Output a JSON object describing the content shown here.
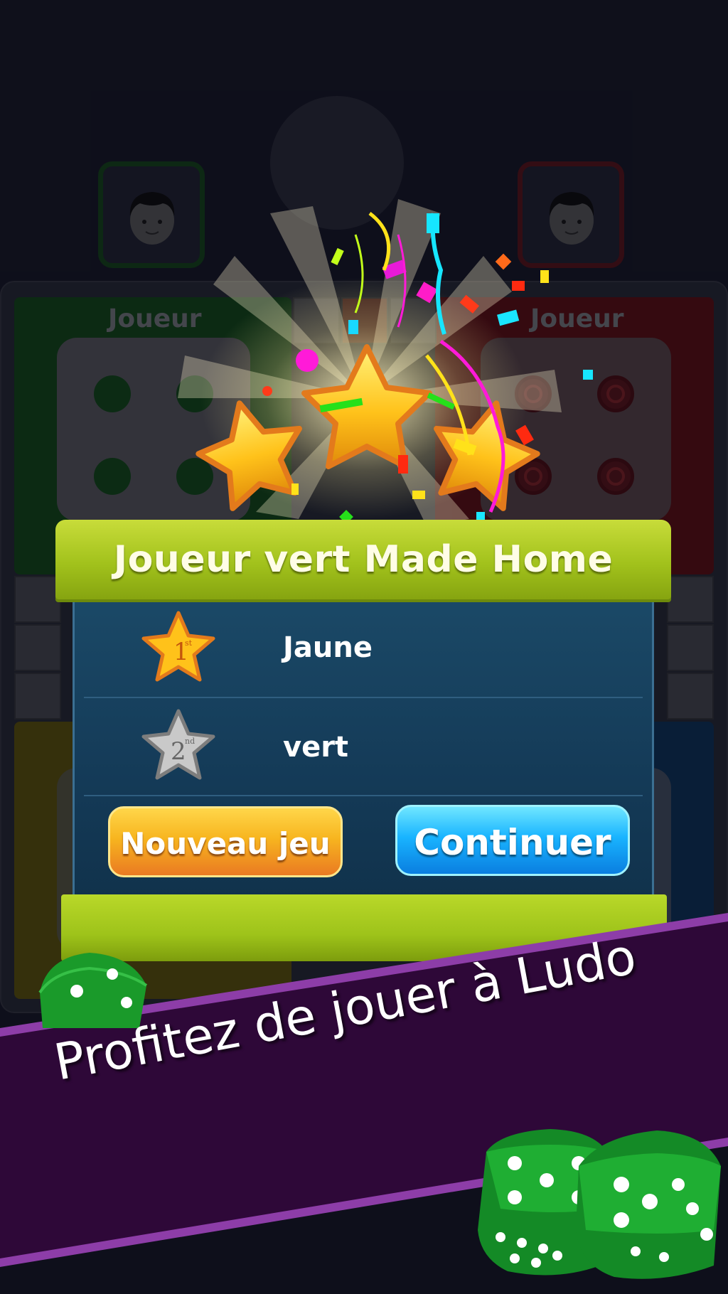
{
  "players": {
    "left_avatar": "boy-avatar-icon",
    "right_avatar": "boy-avatar-icon"
  },
  "board": {
    "green_label": "Joueur",
    "red_label": "Joueur"
  },
  "result": {
    "title": "Joueur vert Made Home",
    "stars_earned": 3,
    "ranks": [
      {
        "position_badge": "1",
        "suffix": "st",
        "name": "Jaune"
      },
      {
        "position_badge": "2",
        "suffix": "nd",
        "name": "vert"
      }
    ],
    "buttons": {
      "new_game": "Nouveau jeu",
      "continue": "Continuer"
    }
  },
  "promo": {
    "tagline": "Profitez de jouer à Ludo"
  },
  "colors": {
    "green_accent": "#a2c21c",
    "orange_button": "#f7b51f",
    "blue_button": "#19b4ff",
    "ribbon_purple": "#2e0838"
  }
}
